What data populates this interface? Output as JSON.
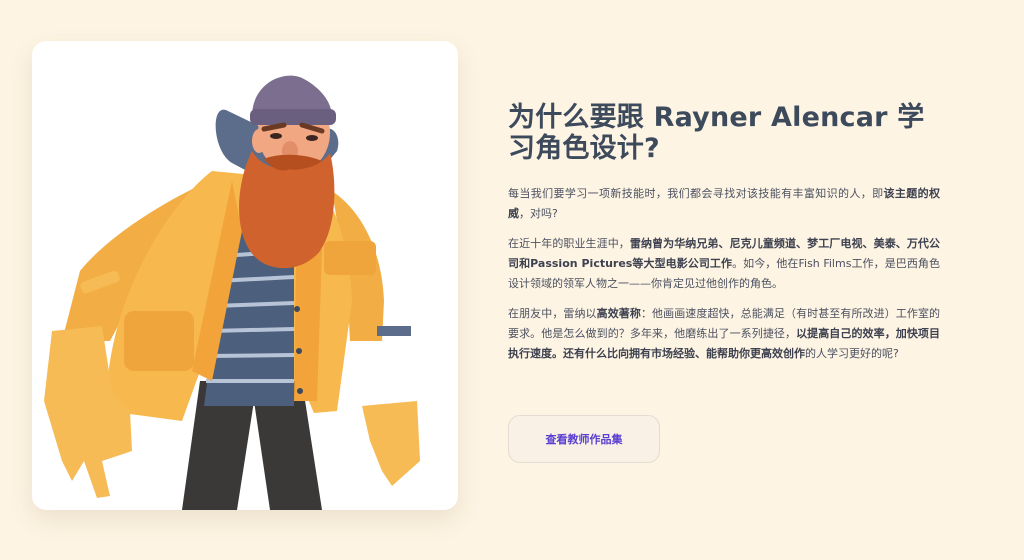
{
  "hero": {
    "title": "为什么要跟 Rayner Alencar 学习角色设计?",
    "paragraphs": [
      [
        {
          "t": "每当我们要学习一项新技能时，我们都会寻找对该技能有丰富知识的人，即",
          "b": false
        },
        {
          "t": "该主题的权威",
          "b": true
        },
        {
          "t": "，对吗?",
          "b": false
        }
      ],
      [
        {
          "t": "在近十年的职业生涯中，",
          "b": false
        },
        {
          "t": "雷纳曾为华纳兄弟、尼克儿童频道、梦工厂电视、美泰、万代公司和Passion Pictures等大型电影公司工作",
          "b": true
        },
        {
          "t": "。如今，他在Fish Films工作，是巴西角色设计领域的领军人物之一——你肯定见过他创作的角色。",
          "b": false
        }
      ],
      [
        {
          "t": "在朋友中，雷纳以",
          "b": false
        },
        {
          "t": "高效著称",
          "b": true
        },
        {
          "t": "：他画画速度超快，总能满足（有时甚至有所改进）工作室的要求。他是怎么做到的？多年来，他磨练出了一系列捷径，",
          "b": false
        },
        {
          "t": "以提高自己的效率，加快项目执行速度。",
          "b": true
        },
        {
          "t": "还有什么比向拥有市场经验、能帮助你",
          "b": true
        },
        {
          "t": "更高效创作",
          "b": true
        },
        {
          "t": "的人学习更好的呢?",
          "b": false
        }
      ]
    ],
    "cta_label": "查看教师作品集"
  },
  "colors": {
    "background": "#fdf4e3",
    "title": "#3d4a5c",
    "cta_text": "#5a3fd1",
    "jacket": "#f7b84e",
    "beard": "#d0622d",
    "beanie": "#7b6e8e"
  },
  "illustration": {
    "icon": "bearded-man-character-illustration"
  }
}
